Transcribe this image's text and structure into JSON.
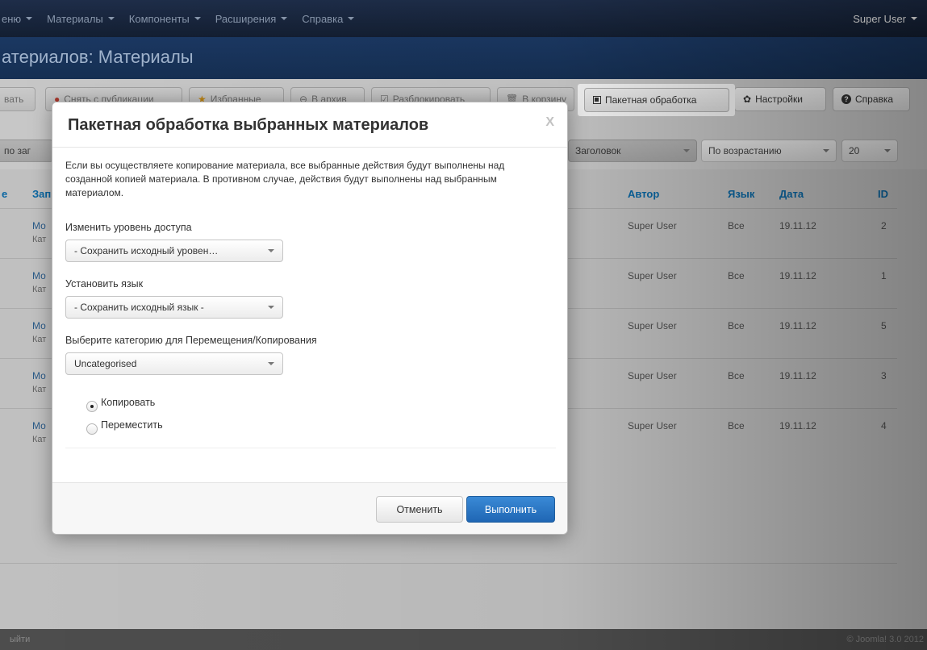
{
  "navbar": {
    "items": [
      {
        "label": "еню"
      },
      {
        "label": "Материалы"
      },
      {
        "label": "Компоненты"
      },
      {
        "label": "Расширения"
      },
      {
        "label": "Справка"
      }
    ],
    "user": "Super User"
  },
  "page_title": "атериалов: Материалы",
  "toolbar": {
    "b0": "вать",
    "b1": "Снять с публикации",
    "b2": "Избранные",
    "b3": "В архив",
    "b4": "Разблокировать",
    "b5": "В корзину",
    "batch": "Пакетная обработка",
    "settings": "Настройки",
    "help": "Справка"
  },
  "filters": {
    "search_placeholder": "по заг",
    "sort_field": "Заголовок",
    "sort_dir": "По возрастанию",
    "limit": "20"
  },
  "table": {
    "headers": {
      "col1": "е",
      "col2": "Зап",
      "author": "Автор",
      "lang": "Язык",
      "date": "Дата",
      "id": "ID"
    },
    "rows": [
      {
        "title": "Мо",
        "cat": "Кат",
        "author": "Super User",
        "lang": "Все",
        "date": "19.11.12",
        "id": "2"
      },
      {
        "title": "Мо",
        "cat": "Кат",
        "author": "Super User",
        "lang": "Все",
        "date": "19.11.12",
        "id": "1"
      },
      {
        "title": "Мо",
        "cat": "Кат",
        "author": "Super User",
        "lang": "Все",
        "date": "19.11.12",
        "id": "5"
      },
      {
        "title": "Мо",
        "cat": "Кат",
        "author": "Super User",
        "lang": "Все",
        "date": "19.11.12",
        "id": "3"
      },
      {
        "title": "Мо",
        "cat": "Кат",
        "author": "Super User",
        "lang": "Все",
        "date": "19.11.12",
        "id": "4"
      }
    ]
  },
  "footer": {
    "left": "ыйти",
    "right": "© Joomla! 3.0 2012"
  },
  "modal": {
    "title": "Пакетная обработка выбранных материалов",
    "close": "X",
    "intro": "Если вы осуществляете копирование материала, все выбранные действия будут выполнены над созданной копией материала. В противном случае, действия будут выполнены над выбранным материалом.",
    "access_label": "Изменить уровень доступа",
    "access_value": "- Сохранить исходный уровен…",
    "lang_label": "Установить язык",
    "lang_value": "- Сохранить исходный язык -",
    "category_label": "Выберите категорию для Перемещения/Копирования",
    "category_value": "Uncategorised",
    "radio_copy": "Копировать",
    "radio_move": "Переместить",
    "selected_action": "Копировать",
    "cancel": "Отменить",
    "submit": "Выполнить"
  }
}
